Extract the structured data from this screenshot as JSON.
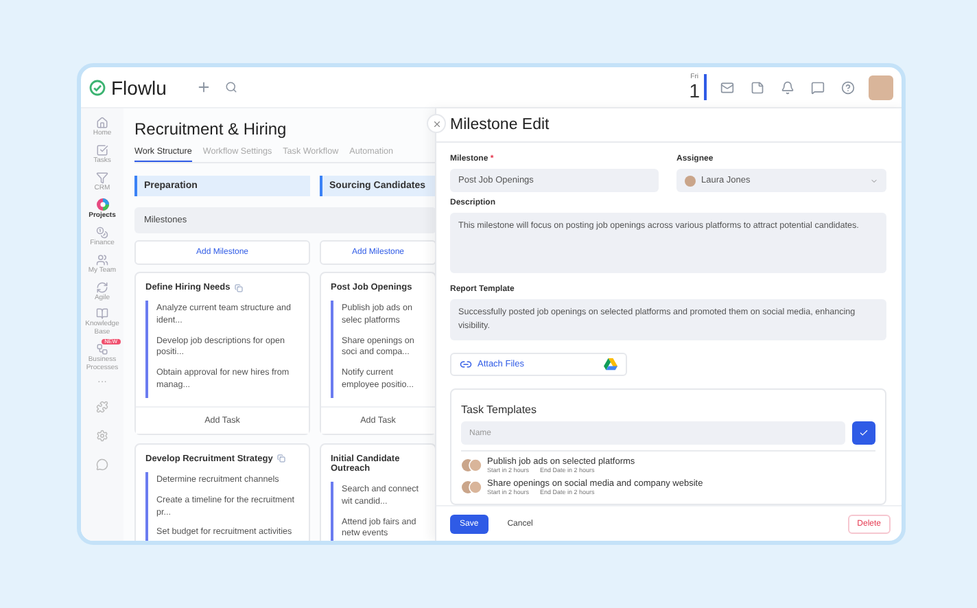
{
  "app": {
    "logo": "Flowlu"
  },
  "header": {
    "day_name": "Fri",
    "day_number": "1"
  },
  "sidebar": {
    "items": [
      {
        "label": "Home",
        "selected": false
      },
      {
        "label": "Tasks",
        "selected": false
      },
      {
        "label": "CRM",
        "selected": false
      },
      {
        "label": "Projects",
        "selected": true
      },
      {
        "label": "Finance",
        "selected": false
      },
      {
        "label": "My Team",
        "selected": false
      },
      {
        "label": "Agile",
        "selected": false
      },
      {
        "label": "Knowledge Base",
        "selected": false
      },
      {
        "label": "Business Processes",
        "selected": false,
        "badge": "NEW"
      }
    ],
    "more": "···"
  },
  "project": {
    "title": "Recruitment & Hiring",
    "tabs": [
      {
        "label": "Work Structure",
        "selected": true
      },
      {
        "label": "Workflow Settings",
        "selected": false
      },
      {
        "label": "Task Workflow",
        "selected": false
      },
      {
        "label": "Automation",
        "selected": false
      }
    ],
    "milestones_label": "Milestones",
    "columns": [
      {
        "stage": "Preparation",
        "add_milestone": "Add Milestone",
        "cards": [
          {
            "title": "Define Hiring Needs",
            "tasks": [
              "Analyze current team structure and ident...",
              "Develop job descriptions for open positi...",
              "Obtain approval for new hires from manag..."
            ],
            "add_task": "Add Task"
          },
          {
            "title": "Develop Recruitment Strategy",
            "tasks": [
              "Determine recruitment channels",
              "Create a timeline for the recruitment pr...",
              "Set budget for recruitment activities"
            ]
          }
        ]
      },
      {
        "stage": "Sourcing Candidates",
        "add_milestone": "Add Milestone",
        "cards": [
          {
            "title": "Post Job Openings",
            "tasks": [
              "Publish job ads on selec platforms",
              "Share openings on soci and compa...",
              "Notify current employee positio..."
            ],
            "add_task": "Add Task"
          },
          {
            "title": "Initial Candidate Outreach",
            "tasks": [
              "Search and connect wit candid...",
              "Attend job fairs and netw events"
            ]
          }
        ]
      }
    ]
  },
  "panel": {
    "title": "Milestone Edit",
    "milestone": {
      "label": "Milestone",
      "required_mark": "*",
      "value": "Post Job Openings"
    },
    "assignee": {
      "label": "Assignee",
      "value": "Laura Jones"
    },
    "description": {
      "label": "Description",
      "value": "This milestone will focus on posting job openings across various platforms to attract potential candidates."
    },
    "report_template": {
      "label": "Report Template",
      "value": "Successfully posted job openings on selected platforms and promoted them on social media, enhancing visibility."
    },
    "attach_files": "Attach Files",
    "task_templates": {
      "title": "Task Templates",
      "name_placeholder": "Name",
      "items": [
        {
          "title": "Publish job ads on selected platforms",
          "start": "Start in 2 hours",
          "end": "End Date in 2 hours"
        },
        {
          "title": "Share openings on social media and company website",
          "start": "Start in 2 hours",
          "end": "End Date in 2 hours"
        }
      ]
    },
    "buttons": {
      "save": "Save",
      "cancel": "Cancel",
      "delete": "Delete"
    }
  }
}
